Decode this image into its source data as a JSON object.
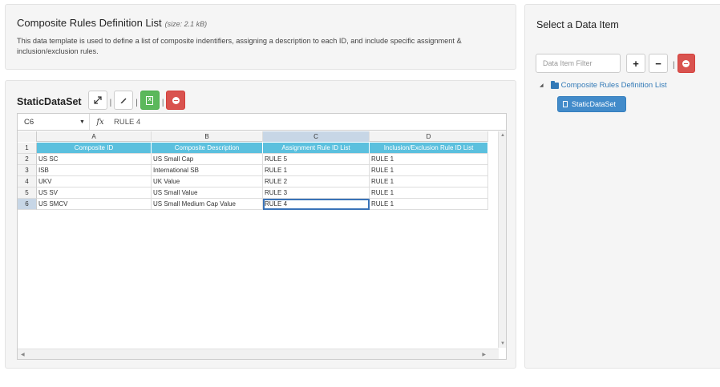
{
  "header": {
    "title": "Composite Rules Definition List",
    "size": "(size: 2.1 kB)",
    "description": "This data template is used to define a list of composite indentifiers, assigning a description to each ID, and include specific assignment & inclusion/exclusion rules."
  },
  "dataset": {
    "title": "StaticDataSet",
    "separator": "|",
    "excel_glyph": "X"
  },
  "sheet": {
    "cell_ref": "C6",
    "fx": "fx",
    "formula": "RULE 4",
    "dropdown_glyph": "▼",
    "columns": [
      "A",
      "B",
      "C",
      "D"
    ],
    "row_numbers": [
      "1",
      "2",
      "3",
      "4",
      "5",
      "6"
    ],
    "headers": [
      "Composite ID",
      "Composite Description",
      "Assignment Rule ID List",
      "Inclusion/Exclusion Rule ID List"
    ],
    "rows": [
      [
        "US SC",
        "US Small Cap",
        "RULE 5",
        "RULE 1"
      ],
      [
        "ISB",
        "International SB",
        "RULE 1",
        "RULE 1"
      ],
      [
        "UKV",
        "UK Value",
        "RULE 2",
        "RULE 1"
      ],
      [
        "US SV",
        "US Small Value",
        "RULE 3",
        "RULE 1"
      ],
      [
        "US SMCV",
        "US Small Medium Cap Value",
        "RULE 4",
        "RULE 1"
      ]
    ]
  },
  "right_panel": {
    "title": "Select a Data Item",
    "filter_placeholder": "Data Item Filter",
    "add_label": "+",
    "remove_label": "−",
    "separator": "|",
    "tree_root": "Composite Rules Definition List",
    "tree_leaf": "StaticDataSet"
  },
  "icons": {
    "expand": "expand-icon",
    "edit": "pencil-icon",
    "excel": "excel-icon",
    "delete": "minus-circle-icon",
    "folder": "folder-icon",
    "document": "document-icon"
  },
  "colors": {
    "header_fill": "#5bc0de",
    "danger": "#d9534f",
    "success": "#5cb85c",
    "primary": "#428bca",
    "link": "#337ab7",
    "selection": "#c7d6e6"
  }
}
